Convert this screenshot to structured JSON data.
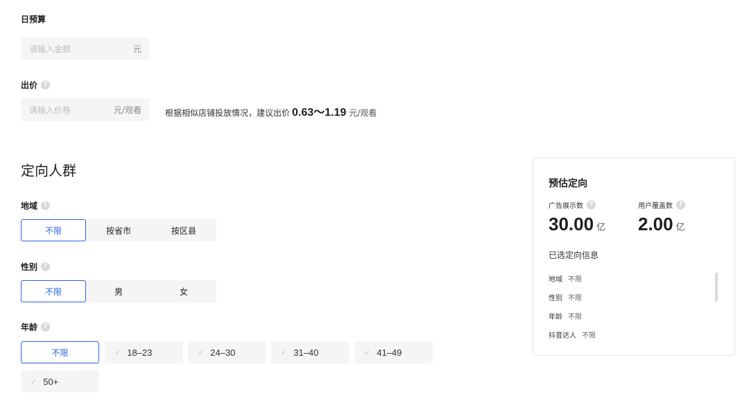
{
  "budget": {
    "label": "日预算",
    "placeholder": "请输入金额",
    "suffix": "元"
  },
  "bid": {
    "label": "出价",
    "placeholder": "请输入价格",
    "suffix": "元/观看",
    "hint_prefix": "根据相似店铺投放情况，建议出价",
    "hint_range": "0.63～1.19",
    "hint_unit": "元/观看"
  },
  "targeting": {
    "title": "定向人群",
    "region": {
      "label": "地域",
      "options": [
        "不限",
        "按省市",
        "按区县"
      ],
      "selected": "不限"
    },
    "gender": {
      "label": "性别",
      "options": [
        "不限",
        "男",
        "女"
      ],
      "selected": "不限"
    },
    "age": {
      "label": "年龄",
      "options": [
        "不限",
        "18–23",
        "24–30",
        "31–40",
        "41–49",
        "50+"
      ],
      "selected": "不限"
    }
  },
  "estimate": {
    "title": "预估定向",
    "impressions_label": "广告展示数",
    "impressions_value": "30.00",
    "impressions_unit": "亿",
    "coverage_label": "用户覆盖数",
    "coverage_value": "2.00",
    "coverage_unit": "亿",
    "selected_title": "已选定向信息",
    "selected": [
      {
        "key": "地域",
        "value": "不限"
      },
      {
        "key": "性别",
        "value": "不限"
      },
      {
        "key": "年龄",
        "value": "不限"
      },
      {
        "key": "抖音达人",
        "value": "不限"
      }
    ]
  },
  "icons": {
    "help": "question-circle-icon",
    "check": "check-icon"
  },
  "colors": {
    "accent": "#2b62e8",
    "input_bg": "#f5f5f5"
  }
}
